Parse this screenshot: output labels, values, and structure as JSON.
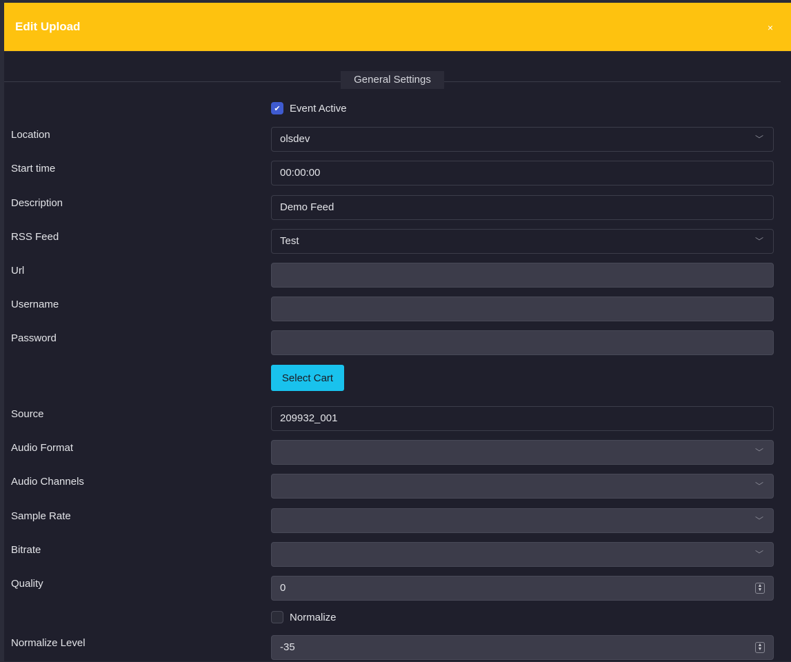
{
  "modal": {
    "title": "Edit Upload",
    "close_icon": "×"
  },
  "section": {
    "title": "General Settings"
  },
  "event_active": {
    "label": "Event Active",
    "checked": true
  },
  "location": {
    "label": "Location",
    "value": "olsdev"
  },
  "start_time": {
    "label": "Start time",
    "value": "00:00:00"
  },
  "description": {
    "label": "Description",
    "value": "Demo Feed"
  },
  "rss_feed": {
    "label": "RSS Feed",
    "value": "Test"
  },
  "url": {
    "label": "Url",
    "value": ""
  },
  "username": {
    "label": "Username",
    "value": ""
  },
  "password": {
    "label": "Password",
    "value": ""
  },
  "select_cart": {
    "label": "Select Cart"
  },
  "source": {
    "label": "Source",
    "value": "209932_001"
  },
  "audio_format": {
    "label": "Audio Format",
    "value": ""
  },
  "audio_channels": {
    "label": "Audio Channels",
    "value": ""
  },
  "sample_rate": {
    "label": "Sample Rate",
    "value": ""
  },
  "bitrate": {
    "label": "Bitrate",
    "value": ""
  },
  "quality": {
    "label": "Quality",
    "value": "0"
  },
  "normalize": {
    "label": "Normalize",
    "checked": false
  },
  "normalize_level": {
    "label": "Normalize Level",
    "value": "-35"
  },
  "colors": {
    "header": "#fec20f",
    "accent": "#19c2ed",
    "checkbox": "#3f5bd0",
    "background": "#1f1f2c"
  }
}
